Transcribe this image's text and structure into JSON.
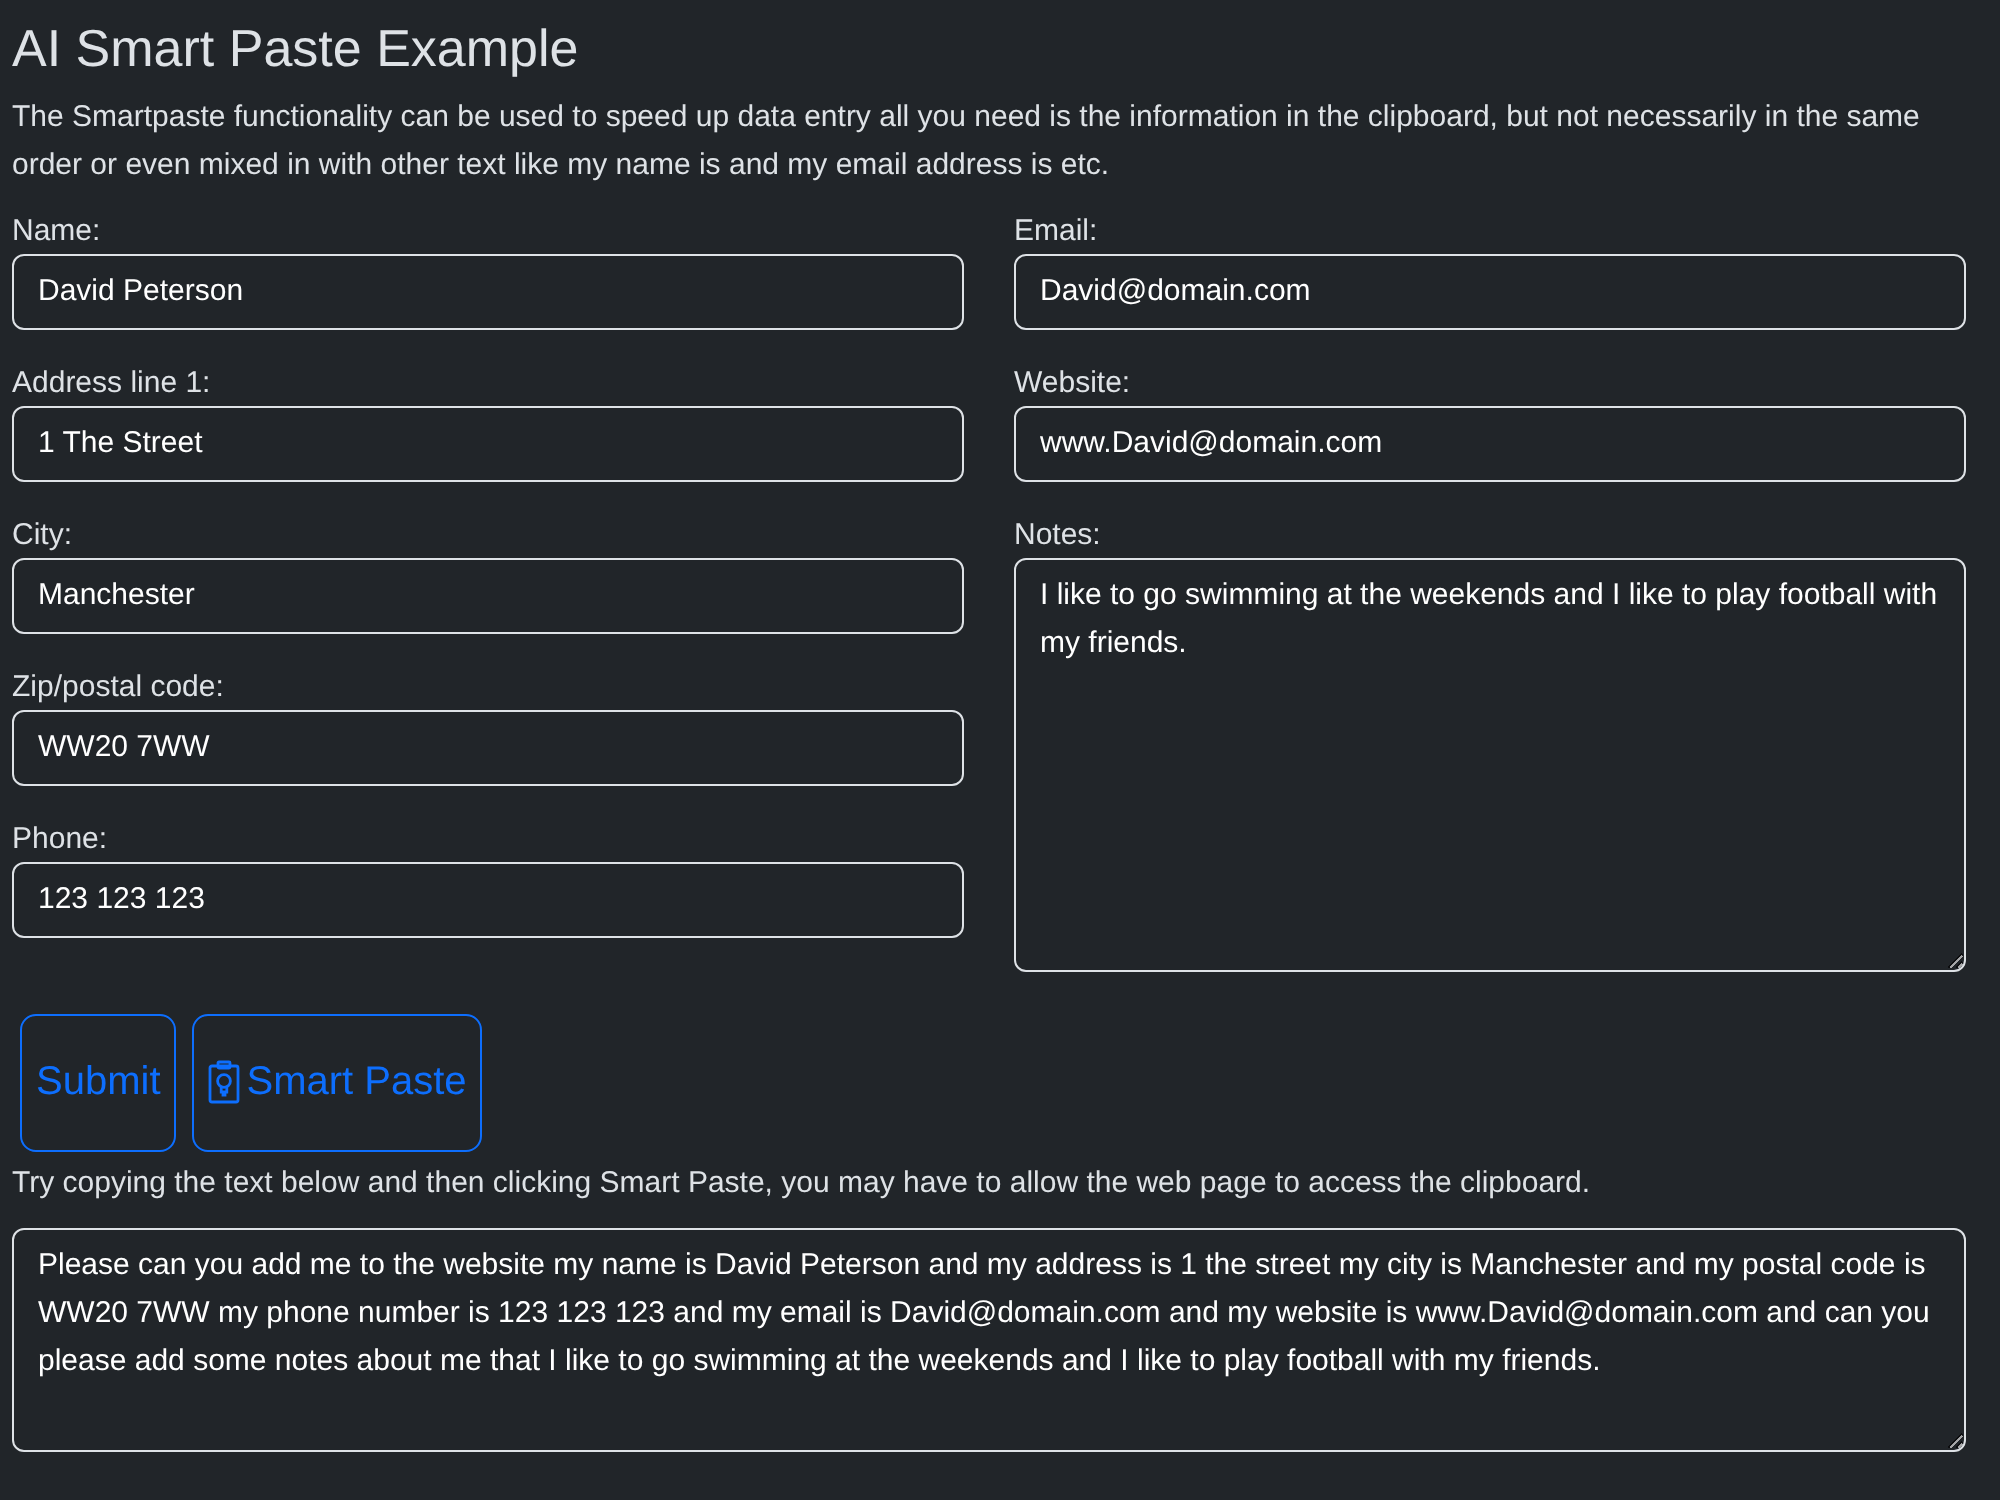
{
  "title": "AI Smart Paste Example",
  "intro": "The Smartpaste functionality can be used to speed up data entry all you need is the information in the clipboard, but not necessarily in the same order or even mixed in with other text like my name is and my email address is etc.",
  "left_fields": [
    {
      "label": "Name:",
      "value": "David Peterson",
      "kind": "input"
    },
    {
      "label": "Address line 1:",
      "value": "1 The Street",
      "kind": "input"
    },
    {
      "label": "City:",
      "value": "Manchester",
      "kind": "input"
    },
    {
      "label": "Zip/postal code:",
      "value": "WW20 7WW",
      "kind": "input"
    },
    {
      "label": "Phone:",
      "value": "123 123 123",
      "kind": "input"
    }
  ],
  "right_fields": [
    {
      "label": "Email:",
      "value": "David@domain.com",
      "kind": "input"
    },
    {
      "label": "Website:",
      "value": "www.David@domain.com",
      "kind": "input"
    },
    {
      "label": "Notes:",
      "value": "I like to go swimming at the weekends and I like to play football with my friends.",
      "kind": "textarea"
    }
  ],
  "buttons": [
    {
      "label": "Submit",
      "kind": "submit"
    },
    {
      "label": "Smart Paste",
      "kind": "smart_paste"
    }
  ],
  "hint": "Try copying the text below and then clicking Smart Paste, you may have to allow the web page to access the clipboard.",
  "sample_text": "Please can you add me to the website my name is David Peterson and my address is 1 the street my city is Manchester and my postal code is WW20 7WW my phone number is 123 123 123 and my email is David@domain.com and my website is www.David@domain.com and can you please add some notes about me that I like to go swimming at the weekends and I like to play football with my friends."
}
